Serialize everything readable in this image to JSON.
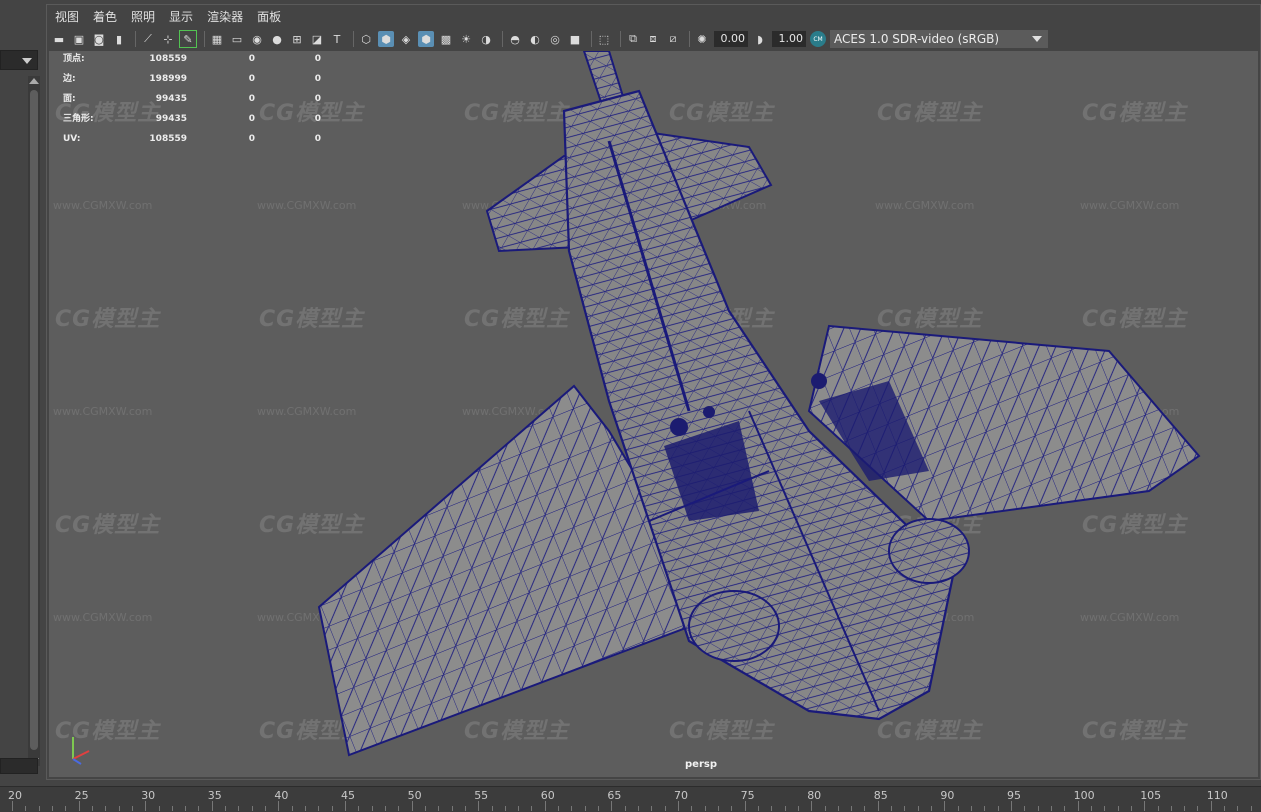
{
  "menu": [
    "视图",
    "着色",
    "照明",
    "显示",
    "渲染器",
    "面板"
  ],
  "toolbar": {
    "exposure_value": "0.00",
    "gamma_value": "1.00",
    "color_badge": "CM",
    "color_space": "ACES 1.0 SDR-video (sRGB)",
    "icons": [
      "camera-icon",
      "camera-attributes-icon",
      "camera-image-plane-icon",
      "bookmark-icon",
      "select-camera-icon",
      "lock-camera-icon",
      "grease-pencil-icon",
      "grid-icon",
      "film-gate-icon",
      "resolution-gate-icon",
      "gate-mask-icon",
      "field-chart-icon",
      "safe-action-icon",
      "safe-title-icon",
      "wireframe-icon",
      "smooth-shade-icon",
      "wireframe-on-shaded-icon",
      "xray-active-icon",
      "textured-icon",
      "use-all-lights-icon",
      "shadows-icon",
      "ambient-occlusion-icon",
      "motion-blur-icon",
      "anti-aliasing-icon",
      "depth-of-field-icon",
      "isolate-select-icon",
      "xray-icon",
      "xray-joints-icon",
      "backface-icon",
      "exposure-icon",
      "gamma-icon"
    ]
  },
  "hud": {
    "rows": [
      {
        "label": "顶点:",
        "v1": "108559",
        "v2": "0",
        "v3": "0"
      },
      {
        "label": "边:",
        "v1": "198999",
        "v2": "0",
        "v3": "0"
      },
      {
        "label": "面:",
        "v1": "99435",
        "v2": "0",
        "v3": "0"
      },
      {
        "label": "三角形:",
        "v1": "99435",
        "v2": "0",
        "v3": "0"
      },
      {
        "label": "UV:",
        "v1": "108559",
        "v2": "0",
        "v3": "0"
      }
    ]
  },
  "viewport": {
    "camera": "persp",
    "watermark_logo": "CG模型主",
    "watermark_url": "www.CGMXW.com"
  },
  "timeline": {
    "ticks": [
      "20",
      "25",
      "30",
      "35",
      "40",
      "45",
      "50",
      "55",
      "60",
      "65",
      "70",
      "75",
      "80",
      "85",
      "90",
      "95",
      "100",
      "105",
      "110"
    ]
  },
  "colors": {
    "wire": "#1a1a7a",
    "mesh_fill": "#8a8a8a",
    "viewport_bg": "#5d5d5d",
    "highlight": "#5a8fb4"
  }
}
